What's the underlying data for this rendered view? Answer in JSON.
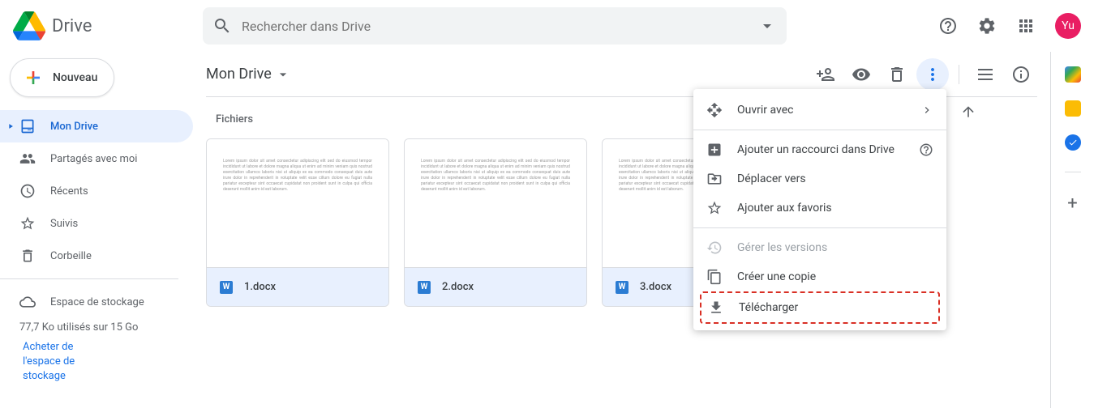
{
  "header": {
    "product": "Drive",
    "search_placeholder": "Rechercher dans Drive",
    "avatar_initials": "Yu"
  },
  "sidebar": {
    "new_button": "Nouveau",
    "items": [
      {
        "label": "Mon Drive"
      },
      {
        "label": "Partagés avec moi"
      },
      {
        "label": "Récents"
      },
      {
        "label": "Suivis"
      },
      {
        "label": "Corbeille"
      }
    ],
    "storage_label": "Espace de stockage",
    "storage_used": "77,7 Ko utilisés sur 15 Go",
    "buy_storage": "Acheter de l'espace de stockage"
  },
  "main": {
    "breadcrumb": "Mon Drive",
    "section": "Fichiers",
    "files": [
      {
        "name": "1.docx"
      },
      {
        "name": "2.docx"
      },
      {
        "name": "3.docx"
      }
    ]
  },
  "context_menu": {
    "open_with": "Ouvrir avec",
    "add_shortcut": "Ajouter un raccourci dans Drive",
    "move_to": "Déplacer vers",
    "star": "Ajouter aux favoris",
    "versions": "Gérer les versions",
    "make_copy": "Créer une copie",
    "download": "Télécharger"
  }
}
